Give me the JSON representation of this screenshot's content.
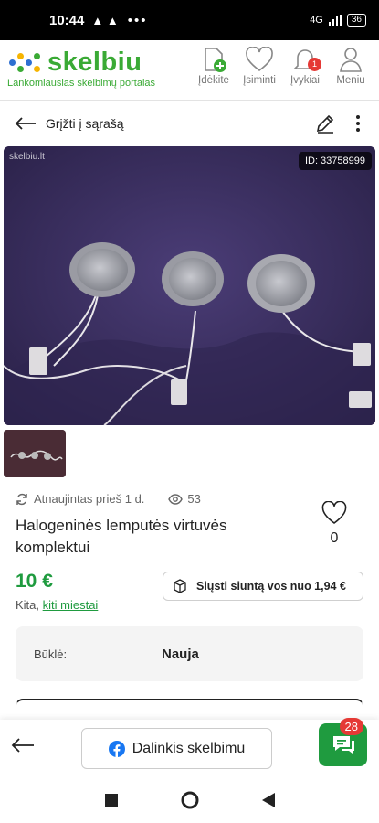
{
  "status_bar": {
    "time": "10:44",
    "alerts": "▲ ▲",
    "dots": "•••",
    "network": "4G",
    "battery": "36"
  },
  "header": {
    "logo_text": "skelbiu",
    "tagline": "Lankomiausias skelbimų portalas",
    "nav": [
      {
        "label": "Įdėkite",
        "icon": "add-ad-icon"
      },
      {
        "label": "Įsiminti",
        "icon": "heart-icon"
      },
      {
        "label": "Įvykiai",
        "icon": "bell-icon",
        "badge": "1"
      },
      {
        "label": "Meniu",
        "icon": "user-icon"
      }
    ]
  },
  "toolbar": {
    "back_label": "Grįžti į sąrašą"
  },
  "photo": {
    "watermark": "skelbiu.lt",
    "id_label": "ID: 33758999"
  },
  "listing": {
    "updated": "Atnaujintas prieš 1 d.",
    "views": "53",
    "title": "Halogeninės lemputės virtuvės komplektui",
    "favorites_count": "0",
    "price": "10 €",
    "location_prefix": "Kita,",
    "location_link": "kiti miestai",
    "shipping_label": "Siųsti siuntą vos nuo 1,94 €",
    "condition_label": "Būklė:",
    "condition_value": "Nauja"
  },
  "bottom_bar": {
    "share_label": "Dalinkis skelbimu",
    "chat_badge": "28"
  },
  "colors": {
    "brand_green": "#3aaa35",
    "price_green": "#1f9b3f",
    "badge_red": "#e53935"
  }
}
